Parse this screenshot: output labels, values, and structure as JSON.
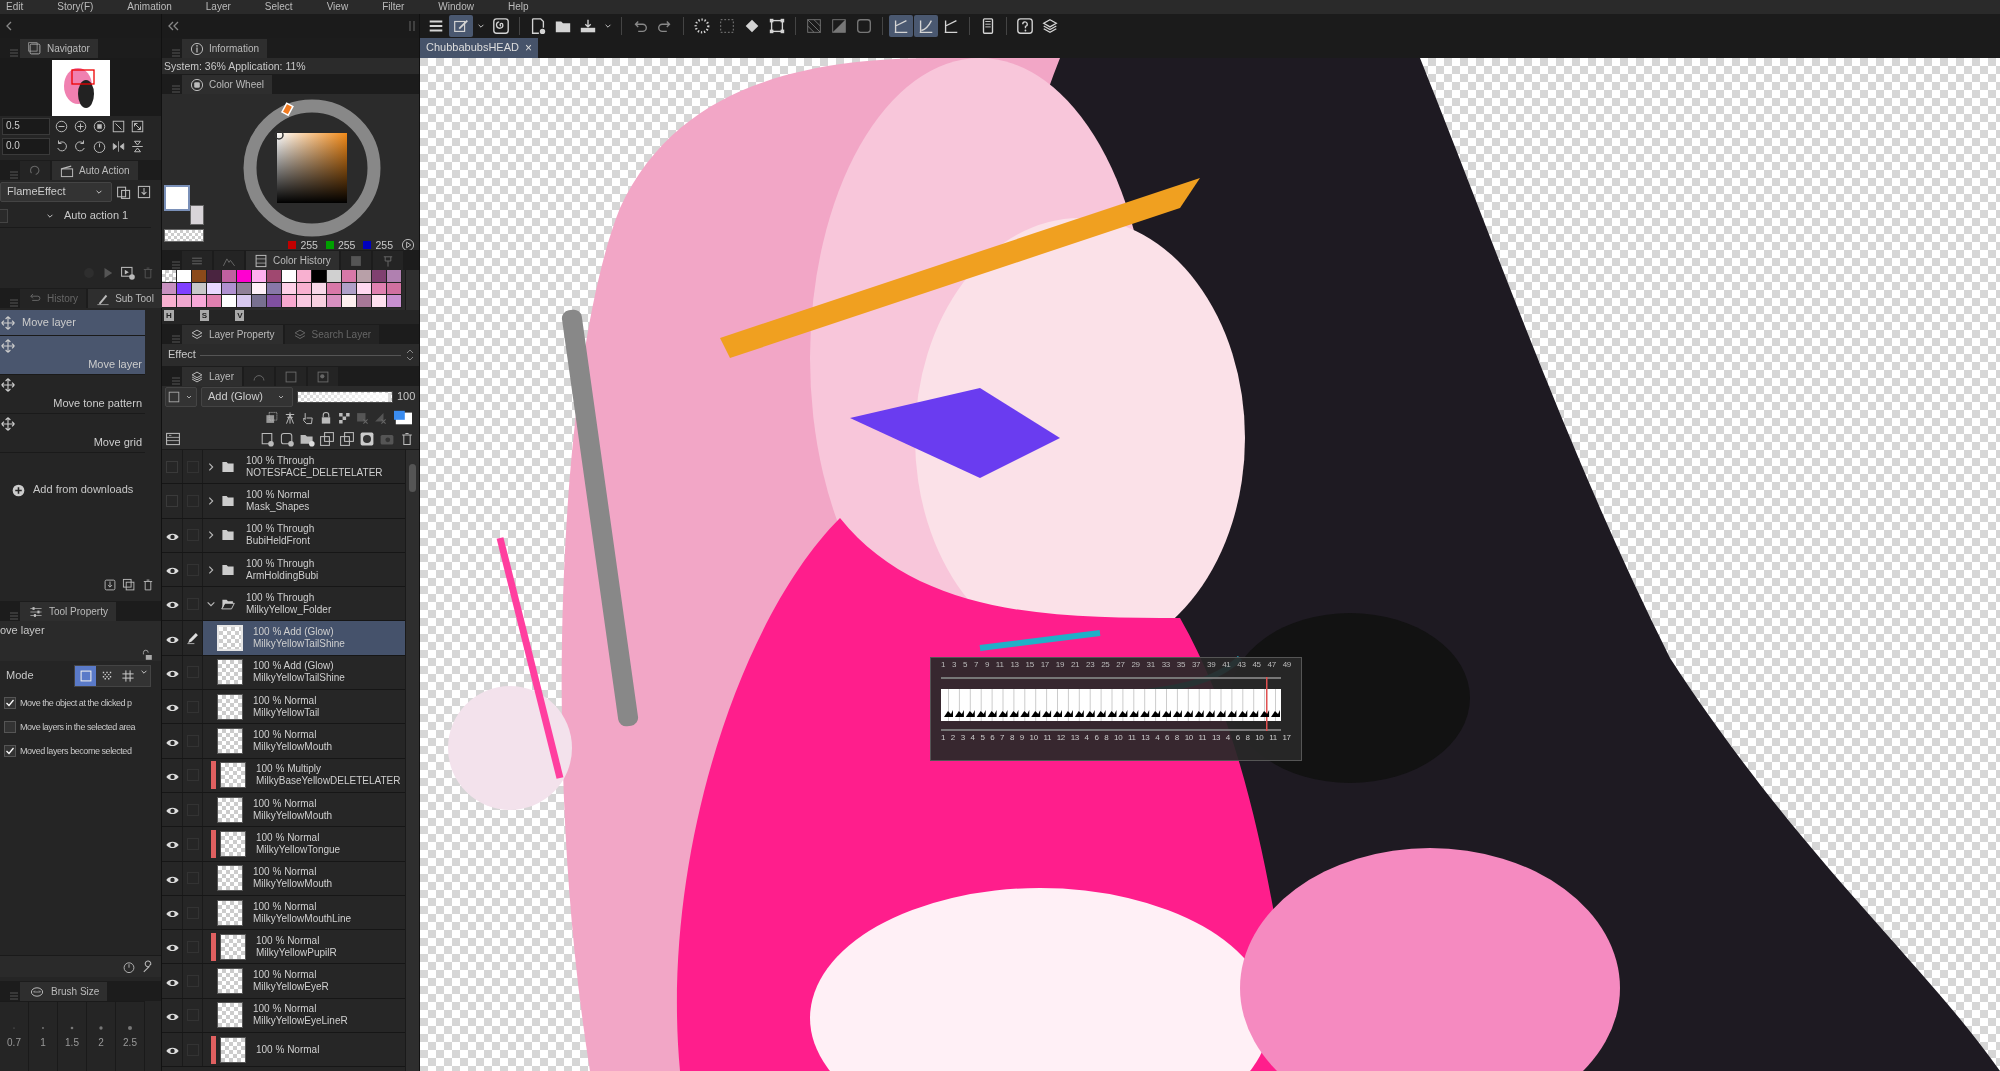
{
  "menu_bar": [
    "Edit",
    "Story(F)",
    "Animation",
    "Layer",
    "Select",
    "View",
    "Filter",
    "Window",
    "Help"
  ],
  "toolbar": [
    {
      "kind": "menu",
      "selected": false
    },
    {
      "kind": "pen",
      "selected": true
    },
    {
      "kind": "caret",
      "selected": false
    },
    {
      "kind": "spiral",
      "selected": false
    },
    {
      "kind": "new-file",
      "selected": false
    },
    {
      "kind": "folder",
      "selected": false
    },
    {
      "kind": "tray",
      "selected": false
    },
    {
      "kind": "caret",
      "selected": false
    },
    {
      "kind": "undo",
      "selected": false
    },
    {
      "kind": "redo",
      "selected": false
    },
    {
      "kind": "dotted-circle",
      "selected": false
    },
    {
      "kind": "dashed-square",
      "selected": false
    },
    {
      "kind": "bucket",
      "selected": false
    },
    {
      "kind": "transform",
      "selected": false
    },
    {
      "kind": "hatched-square",
      "selected": false
    },
    {
      "kind": "half-square",
      "selected": false
    },
    {
      "kind": "rounded-square",
      "selected": false
    },
    {
      "kind": "ruler",
      "selected": true
    },
    {
      "kind": "curve",
      "selected": true
    },
    {
      "kind": "ruler",
      "selected": false
    },
    {
      "kind": "device",
      "selected": false
    },
    {
      "kind": "help",
      "selected": false
    },
    {
      "kind": "layers",
      "selected": false
    }
  ],
  "document_tabs": [
    {
      "title": "ChubbabubsHEAD",
      "close": "×",
      "selected": true
    }
  ],
  "navigator": {
    "tab": "Navigator",
    "zoom": "0.5",
    "rotation": "0.0"
  },
  "auto_action": {
    "tab": "Auto Action",
    "set": "FlameEffect",
    "actions": [
      {
        "label": "Auto action 1",
        "checked": false
      }
    ]
  },
  "sub_tool_tabs": [
    {
      "label": "History",
      "selected": false
    },
    {
      "label": "Sub Tool",
      "selected": true
    }
  ],
  "sub_tools": [
    {
      "label": "Move layer",
      "kind": "compact",
      "selected": true
    },
    {
      "label": "Move layer",
      "kind": "tall",
      "selected": true
    },
    {
      "label": "Move tone pattern",
      "kind": "tall",
      "selected": false
    },
    {
      "label": "Move grid",
      "kind": "tall",
      "selected": false
    }
  ],
  "add_from_downloads": "Add from downloads",
  "tool_property": {
    "tab": "Tool Property",
    "tool": "ove layer",
    "mode_label": "Mode",
    "modes": [
      {
        "kind": "square",
        "selected": true
      },
      {
        "kind": "dots",
        "selected": false
      },
      {
        "kind": "grid",
        "selected": false
      }
    ],
    "options": [
      {
        "label": "Move the object at the clicked p",
        "checked": true
      },
      {
        "label": "Move layers in the selected area",
        "checked": false
      },
      {
        "label": "Moved layers become selected",
        "checked": true
      }
    ]
  },
  "brush_size": {
    "tab": "Brush Size",
    "sizes": [
      "0.7",
      "1",
      "1.5",
      "2",
      "2.5"
    ]
  },
  "information": {
    "tab": "Information",
    "text": "System: 36% Application: 11%"
  },
  "color_wheel": {
    "tab": "Color Wheel",
    "rgb": [
      "255",
      "255",
      "255"
    ]
  },
  "color_history": {
    "tab": "Color History",
    "hsv": [
      "H",
      "S",
      "V"
    ],
    "swatches": [
      {
        "kind": "transparent"
      },
      {
        "color": "#ffffff"
      },
      {
        "color": "#8b4a1a"
      },
      {
        "color": "#4a2440"
      },
      {
        "color": "#c060a0"
      },
      {
        "color": "#ff00d0"
      },
      {
        "color": "#ffb0f0"
      },
      {
        "color": "#a04870"
      },
      {
        "color": "#ffffff"
      },
      {
        "color": "#f8b0d0"
      },
      {
        "color": "#000000"
      },
      {
        "color": "#d0d0d0"
      },
      {
        "color": "#d878a8"
      },
      {
        "color": "#b8a0a8"
      },
      {
        "color": "#804070"
      },
      {
        "color": "#b080b0"
      },
      {
        "color": "#c890c0"
      },
      {
        "color": "#8040ff"
      },
      {
        "color": "#c8c8c8"
      },
      {
        "color": "#e8d8ff"
      },
      {
        "color": "#b090d0"
      },
      {
        "color": "#908098"
      },
      {
        "color": "#fff0f8"
      },
      {
        "color": "#8878a8"
      },
      {
        "color": "#ffd0e8"
      },
      {
        "color": "#f8b0d0"
      },
      {
        "color": "#f8d8e8"
      },
      {
        "color": "#d878a8"
      },
      {
        "color": "#b0a0c8"
      },
      {
        "color": "#ffd8f0"
      },
      {
        "color": "#e080b0"
      },
      {
        "color": "#d070a0"
      },
      {
        "color": "#f8b0d0"
      },
      {
        "color": "#f0a8d0"
      },
      {
        "color": "#f8a8d8"
      },
      {
        "color": "#e080b0"
      },
      {
        "color": "#ffffff"
      },
      {
        "color": "#d8c8f0"
      },
      {
        "color": "#787090"
      },
      {
        "color": "#8050a0"
      },
      {
        "color": "#f8a8d0"
      },
      {
        "color": "#f8c8e0"
      },
      {
        "color": "#f8d0e0"
      },
      {
        "color": "#d890c0"
      },
      {
        "color": "#fff0f0"
      },
      {
        "color": "#a87898"
      },
      {
        "color": "#ffe0f0"
      },
      {
        "color": "#c890d0"
      }
    ]
  },
  "layer_property": {
    "tabs": [
      {
        "label": "Layer Property",
        "selected": true
      },
      {
        "label": "Search Layer",
        "selected": false
      }
    ],
    "effect": "Effect"
  },
  "layer_panel": {
    "tab": "Layer",
    "blend_mode": "Add (Glow)",
    "opacity": "100",
    "opacity_slider": {
      "level": 1
    }
  },
  "layers": [
    {
      "kind": "folder",
      "visible": false,
      "expanded": false,
      "blend": "100 % Through",
      "name": "NOTESFACE_DELETELATER"
    },
    {
      "kind": "folder",
      "visible": false,
      "expanded": false,
      "blend": "100 % Normal",
      "name": "Mask_Shapes"
    },
    {
      "kind": "folder",
      "visible": true,
      "expanded": false,
      "blend": "100 % Through",
      "name": "BubiHeldFront"
    },
    {
      "kind": "folder",
      "visible": true,
      "expanded": false,
      "blend": "100 % Through",
      "name": "ArmHoldingBubi"
    },
    {
      "kind": "folder",
      "visible": true,
      "expanded": true,
      "blend": "100 % Through",
      "name": "MilkyYellow_Folder",
      "children": [
        {
          "kind": "layer",
          "visible": true,
          "selected": true,
          "editing": true,
          "blend": "100 % Add (Glow)",
          "name": "MilkyYellowTailShine"
        },
        {
          "kind": "layer",
          "visible": true,
          "selected": false,
          "editing": false,
          "blend": "100 % Add (Glow)",
          "name": "MilkyYellowTailShine"
        },
        {
          "kind": "layer",
          "visible": true,
          "selected": false,
          "editing": false,
          "blend": "100 % Normal",
          "name": "MilkyYellowTail"
        },
        {
          "kind": "layer",
          "visible": true,
          "selected": false,
          "editing": false,
          "blend": "100 % Normal",
          "name": "MilkyYellowMouth"
        },
        {
          "kind": "layer",
          "visible": true,
          "selected": false,
          "editing": false,
          "blend": "100 % Multiply",
          "name": "MilkyBaseYellowDELETELATER",
          "color": "#e06060"
        },
        {
          "kind": "layer",
          "visible": true,
          "selected": false,
          "editing": false,
          "blend": "100 % Normal",
          "name": "MilkyYellowMouth"
        },
        {
          "kind": "layer",
          "visible": true,
          "selected": false,
          "editing": false,
          "blend": "100 % Normal",
          "name": "MilkyYellowTongue",
          "color": "#e06060"
        },
        {
          "kind": "layer",
          "visible": true,
          "selected": false,
          "editing": false,
          "blend": "100 % Normal",
          "name": "MilkyYellowMouth"
        },
        {
          "kind": "layer",
          "visible": true,
          "selected": false,
          "editing": false,
          "blend": "100 % Normal",
          "name": "MilkyYellowMouthLine"
        },
        {
          "kind": "layer",
          "visible": true,
          "selected": false,
          "editing": false,
          "blend": "100 % Normal",
          "name": "MilkyYellowPupilR",
          "color": "#e06060"
        },
        {
          "kind": "layer",
          "visible": true,
          "selected": false,
          "editing": false,
          "blend": "100 % Normal",
          "name": "MilkyYellowEyeR"
        },
        {
          "kind": "layer",
          "visible": true,
          "selected": false,
          "editing": false,
          "blend": "100 % Normal",
          "name": "MilkyYellowEyeLineR"
        },
        {
          "kind": "layer",
          "visible": true,
          "selected": false,
          "editing": false,
          "blend": "100 % Normal",
          "color": "#e06060"
        }
      ]
    }
  ],
  "timeline": {
    "frames": [
      "1",
      "3",
      "5",
      "7",
      "9",
      "11",
      "13",
      "15",
      "17",
      "19",
      "21",
      "23",
      "25",
      "27",
      "29",
      "31",
      "33",
      "35",
      "37",
      "39",
      "41",
      "43",
      "45",
      "47",
      "49"
    ],
    "cels": [
      "1",
      "2",
      "3",
      "4",
      "5",
      "6",
      "7",
      "8",
      "9",
      "10",
      "11",
      "12",
      "13",
      "4",
      "6",
      "8",
      "10",
      "11",
      "13",
      "4",
      "6",
      "8",
      "10",
      "11",
      "13",
      "4",
      "6",
      "8",
      "10",
      "11",
      "17"
    ]
  }
}
